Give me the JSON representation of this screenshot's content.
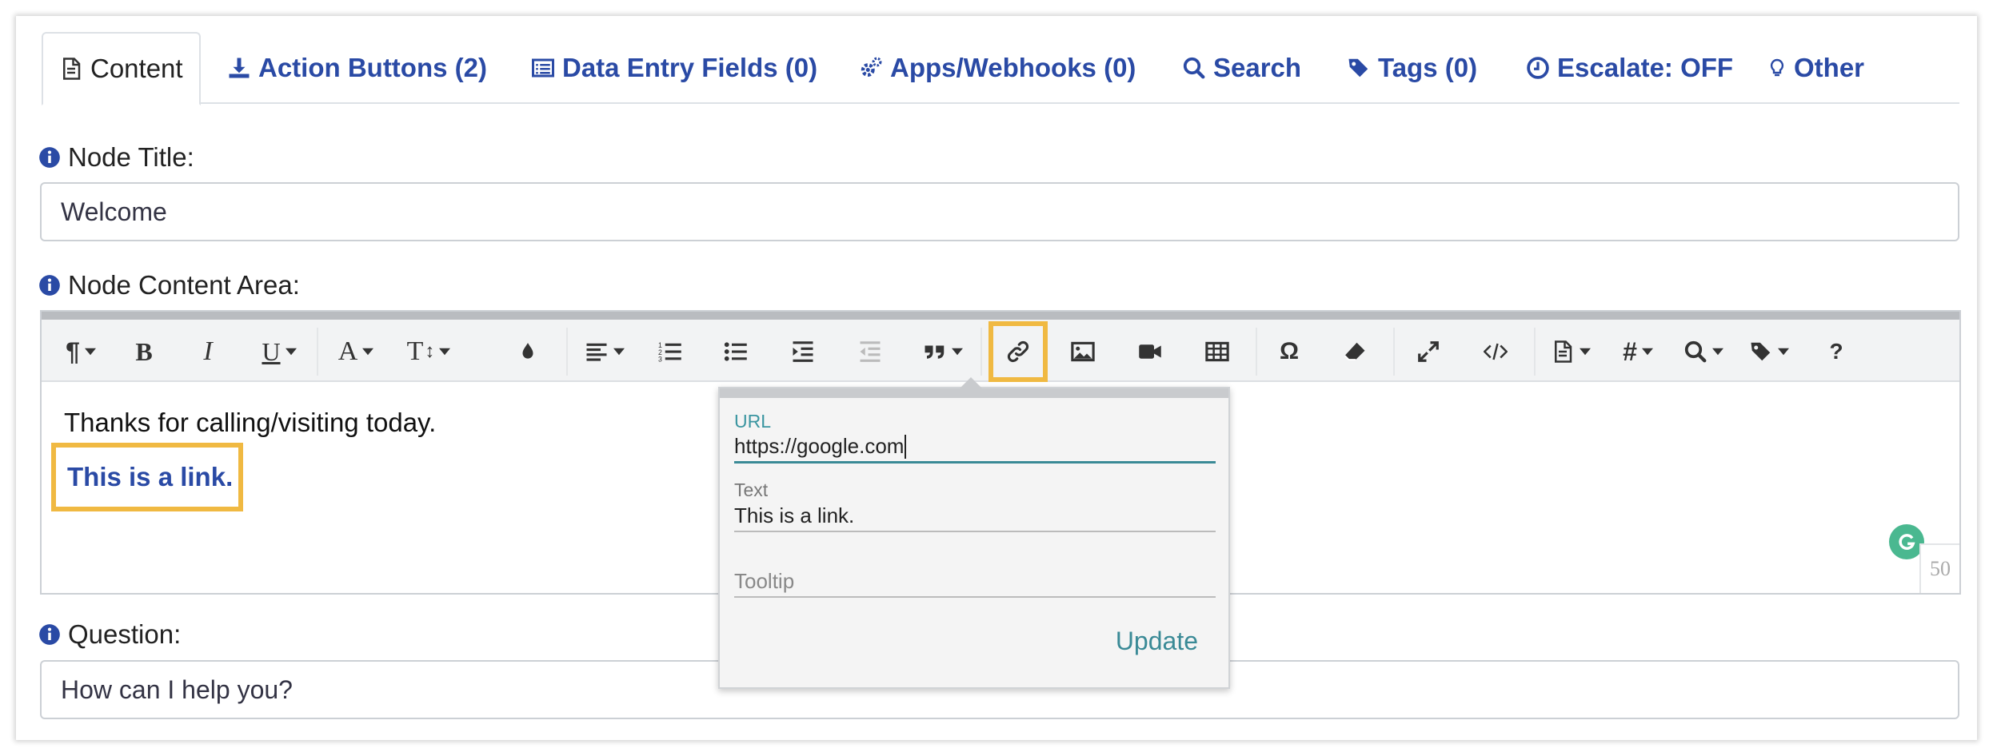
{
  "tabs": [
    {
      "label": "Content",
      "icon": "document-icon"
    },
    {
      "label": "Action Buttons (2)",
      "icon": "download-icon"
    },
    {
      "label": "Data Entry Fields (0)",
      "icon": "list-icon"
    },
    {
      "label": "Apps/Webhooks (0)",
      "icon": "gears-icon"
    },
    {
      "label": "Search",
      "icon": "search-icon"
    },
    {
      "label": "Tags (0)",
      "icon": "tags-icon"
    },
    {
      "label": "Escalate: OFF",
      "icon": "clock-icon"
    },
    {
      "label": "Other",
      "icon": "lightbulb-icon"
    }
  ],
  "node_title": {
    "label": "Node Title:",
    "value": "Welcome"
  },
  "node_content": {
    "label": "Node Content Area:",
    "lines": [
      "Thanks for calling/visiting today."
    ],
    "link_text": "This is a link.",
    "char_count": "50"
  },
  "question": {
    "label": "Question:",
    "value": "How can I help you?"
  },
  "link_popup": {
    "url_label": "URL",
    "url_value": "https://google.com",
    "text_label": "Text",
    "text_value": "This is a link.",
    "tooltip_placeholder": "Tooltip",
    "update_label": "Update"
  },
  "toolbar": {
    "omega_glyph": "Ω",
    "help_glyph": "?",
    "text_size_glyph": "T",
    "bold_glyph": "B",
    "italic_glyph": "I",
    "underline_glyph": "U",
    "font_color_glyph": "A",
    "hash_glyph": "#",
    "paragraph_glyph": "¶"
  },
  "colors": {
    "accent_blue": "#2a4aa5",
    "highlight": "#f0b942",
    "teal": "#3a8a96",
    "grammarly": "#4ab890"
  }
}
